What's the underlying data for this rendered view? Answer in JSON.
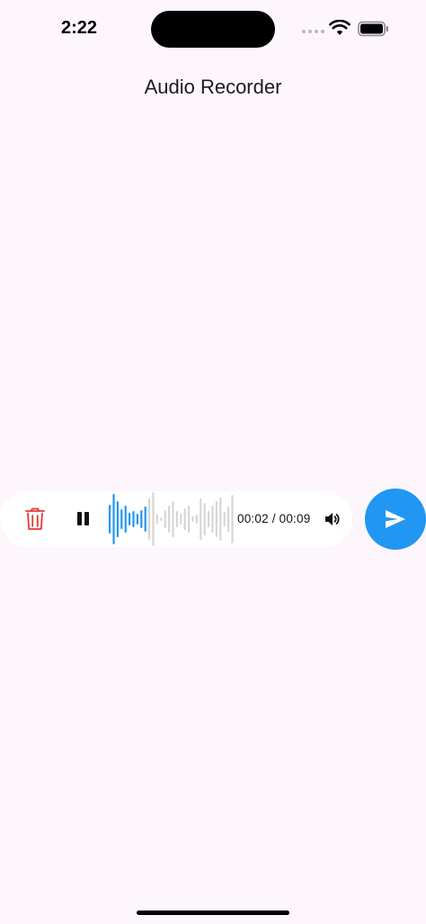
{
  "status_bar": {
    "time": "2:22",
    "icons": [
      "cellular-dots-icon",
      "wifi-icon",
      "battery-icon"
    ]
  },
  "header": {
    "title": "Audio Recorder"
  },
  "player": {
    "time_display": "00:02 / 00:09",
    "playback_progress": 0.3,
    "state": "playing",
    "icons": {
      "delete": "trash-icon",
      "pause": "pause-icon",
      "volume": "volume-icon",
      "send": "send-icon"
    }
  },
  "colors": {
    "background": "#fdf6fc",
    "player_background": "#ffffff",
    "accent": "#2196f3",
    "waveform_played": "#2196f3",
    "waveform_unplayed": "#d6d6d6",
    "delete": "#e53935"
  }
}
